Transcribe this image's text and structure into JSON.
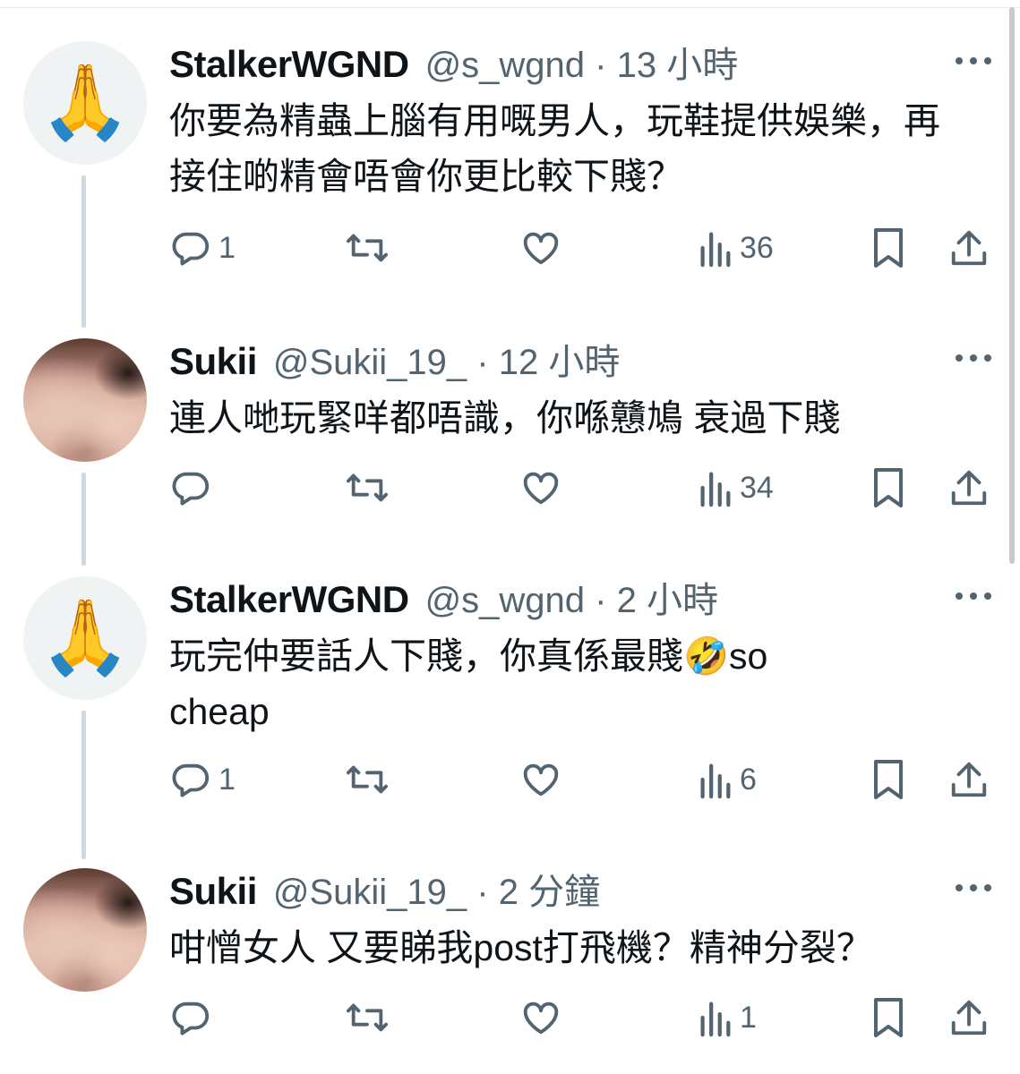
{
  "tweets": [
    {
      "name": "StalkerWGND",
      "handle_time": "@s_wgnd · 13 小時",
      "avatar": "folded-hands-emoji",
      "avatar_glyph": "🙏",
      "text": "你要為精蟲上腦有用嘅男人，玩鞋提供娛樂，再接住啲精會唔會你更比較下賤？",
      "replies": "1",
      "retweets": "",
      "likes": "",
      "views": "36"
    },
    {
      "name": "Sukii",
      "handle_time": "@Sukii_19_ · 12 小時",
      "avatar": "photo",
      "text": "連人哋玩緊咩都唔識，你喺戇鳩 衰過下賤",
      "replies": "",
      "retweets": "",
      "likes": "",
      "views": "34"
    },
    {
      "name": "StalkerWGND",
      "handle_time": "@s_wgnd · 2 小時",
      "avatar": "folded-hands-emoji",
      "avatar_glyph": "🙏",
      "text": "玩完仲要話人下賤，你真係最賤🤣so cheap",
      "replies": "1",
      "retweets": "",
      "likes": "",
      "views": "6"
    },
    {
      "name": "Sukii",
      "handle_time": "@Sukii_19_ · 2 分鐘",
      "avatar": "photo",
      "text": "咁憎女人 又要睇我post打飛機？精神分裂？",
      "replies": "",
      "retweets": "",
      "likes": "",
      "views": "1"
    }
  ],
  "icons": {
    "reply": "reply-icon",
    "retweet": "retweet-icon",
    "like": "heart-icon",
    "views": "views-icon",
    "bookmark": "bookmark-icon",
    "share": "share-icon",
    "more": "more-icon"
  },
  "colors": {
    "text": "#0f1419",
    "secondary": "#536471",
    "thread_line": "#cfd9de"
  }
}
